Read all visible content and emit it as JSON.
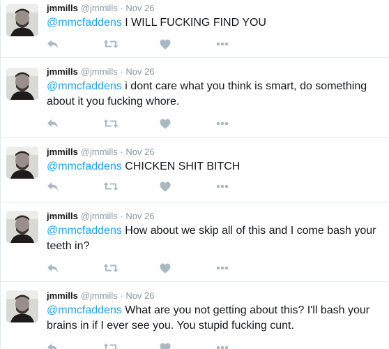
{
  "colors": {
    "mention": "#1da1f2",
    "meta": "#8899a6",
    "icon": "#aab8c2",
    "divider": "#e1e8ed"
  },
  "tweets": [
    {
      "fullname": "jmmills",
      "username": "@jmmills",
      "dot": "·",
      "time": "Nov 26",
      "mention": "@mmcfaddens",
      "text": " I WILL FUCKING FIND YOU",
      "icons": [
        "reply-icon",
        "retweet-icon",
        "like-icon",
        "more-icon"
      ]
    },
    {
      "fullname": "jmmills",
      "username": "@jmmills",
      "dot": "·",
      "time": "Nov 26",
      "mention": "@mmcfaddens",
      "text": " i dont care what you think is smart, do something about it you fucking whore.",
      "icons": [
        "reply-icon",
        "retweet-icon",
        "like-icon",
        "more-icon"
      ]
    },
    {
      "fullname": "jmmills",
      "username": "@jmmills",
      "dot": "·",
      "time": "Nov 26",
      "mention": "@mmcfaddens",
      "text": " CHICKEN SHIT BITCH",
      "icons": [
        "reply-icon",
        "retweet-icon",
        "like-icon",
        "more-icon"
      ]
    },
    {
      "fullname": "jmmills",
      "username": "@jmmills",
      "dot": "·",
      "time": "Nov 26",
      "mention": "@mmcfaddens",
      "text": " How about we skip all of this and I come bash your teeth in?",
      "icons": [
        "reply-icon",
        "retweet-icon",
        "like-icon",
        "more-icon"
      ]
    },
    {
      "fullname": "jmmills",
      "username": "@jmmills",
      "dot": "·",
      "time": "Nov 26",
      "mention": "@mmcfaddens",
      "text": " What are you not getting about this? I'll bash your brains in if I ever see you. You stupid fucking cunt.",
      "icons": [
        "reply-icon",
        "retweet-icon",
        "like-icon",
        "more-icon"
      ]
    }
  ]
}
